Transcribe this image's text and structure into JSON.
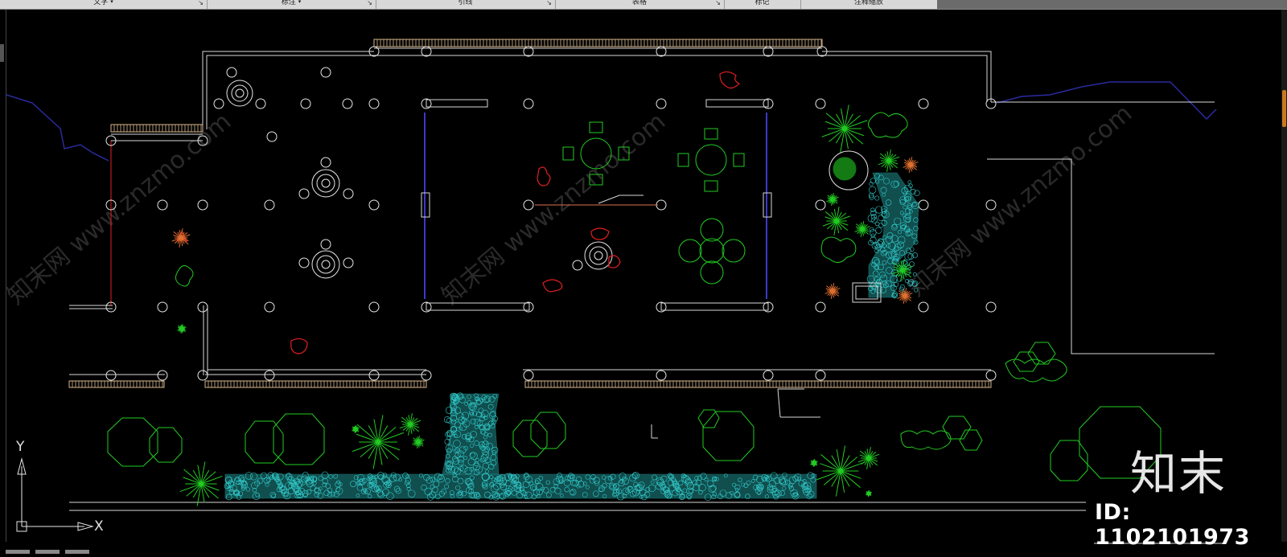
{
  "ribbon": {
    "panels": [
      {
        "label": "文字",
        "has_dropdown": true
      },
      {
        "label": "标注",
        "has_dropdown": true
      },
      {
        "label": "引线"
      },
      {
        "label": "表格"
      },
      {
        "label": "标记"
      },
      {
        "label": "注释缩放"
      }
    ]
  },
  "ucs": {
    "x_label": "X",
    "y_label": "Y"
  },
  "watermark": {
    "logo": "知末",
    "id_text": "ID: 1102101973",
    "diagonal_text": "知末网 www.znzmo.com"
  },
  "colors": {
    "background": "#000000",
    "wall": "#d8d8d8",
    "plant_green": "#22dd22",
    "paving_cyan": "#33cccc",
    "accent_red": "#e02020",
    "blue_line": "#2a2aa0"
  }
}
